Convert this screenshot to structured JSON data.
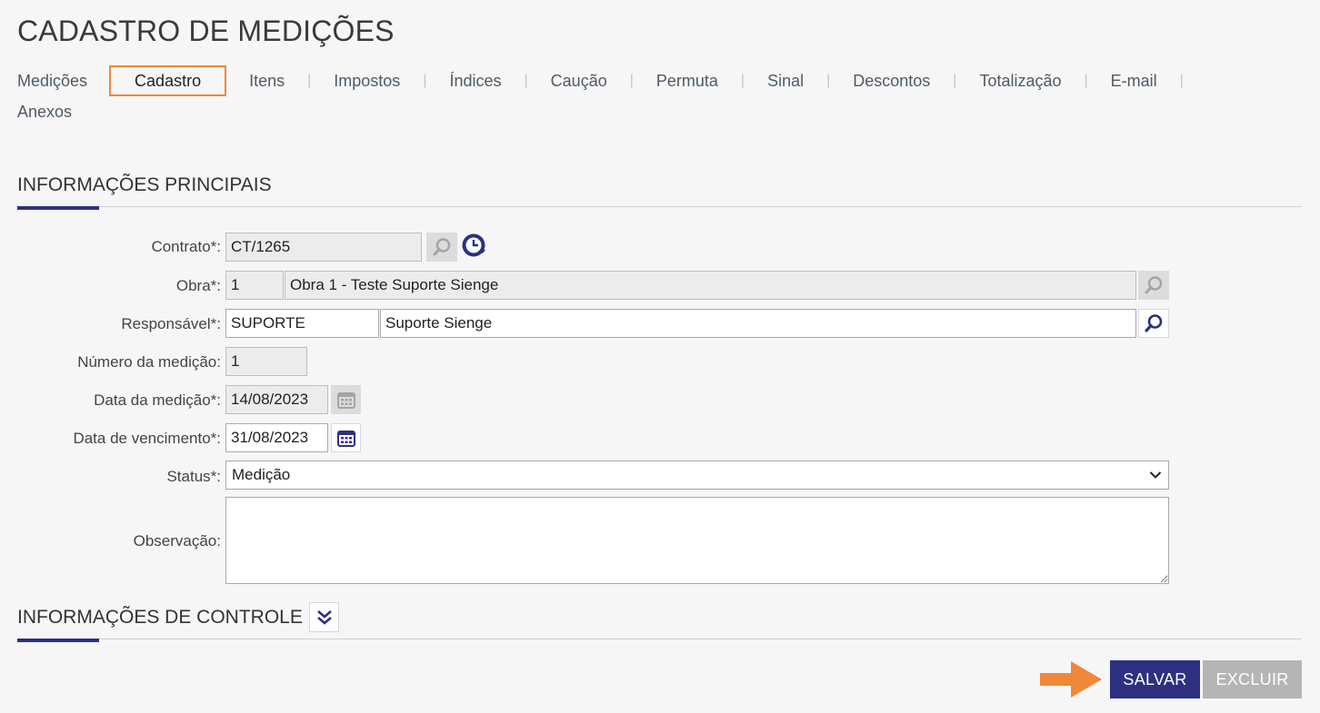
{
  "page": {
    "title": "CADASTRO DE MEDIÇÕES"
  },
  "tabs": {
    "items": [
      {
        "label": "Medições"
      },
      {
        "label": "Cadastro"
      },
      {
        "label": "Itens"
      },
      {
        "label": "Impostos"
      },
      {
        "label": "Índices"
      },
      {
        "label": "Caução"
      },
      {
        "label": "Permuta"
      },
      {
        "label": "Sinal"
      },
      {
        "label": "Descontos"
      },
      {
        "label": "Totalização"
      },
      {
        "label": "E-mail"
      },
      {
        "label": "Anexos"
      }
    ],
    "active": "Cadastro",
    "separator": "|"
  },
  "sections": {
    "main": {
      "title": "INFORMAÇÕES PRINCIPAIS"
    },
    "control": {
      "title": "INFORMAÇÕES DE CONTROLE"
    }
  },
  "form": {
    "contrato": {
      "label": "Contrato*:",
      "value": "CT/1265"
    },
    "obra": {
      "label": "Obra*:",
      "code": "1",
      "name": "Obra 1 - Teste Suporte Sienge"
    },
    "responsavel": {
      "label": "Responsável*:",
      "code": "SUPORTE",
      "name": "Suporte Sienge"
    },
    "numero": {
      "label": "Número da medição:",
      "value": "1"
    },
    "data_medicao": {
      "label": "Data da medição*:",
      "value": "14/08/2023"
    },
    "data_vencimento": {
      "label": "Data de vencimento*:",
      "value": "31/08/2023"
    },
    "status": {
      "label": "Status*:",
      "value": "Medição"
    },
    "observacao": {
      "label": "Observação:",
      "value": ""
    }
  },
  "buttons": {
    "save": "SALVAR",
    "delete": "EXCLUIR"
  },
  "icons": {
    "search": "search-icon",
    "history": "clock-icon",
    "calendar": "calendar-icon",
    "expand": "double-chevron-down-icon",
    "arrow": "arrow-right-icon"
  },
  "colors": {
    "primary": "#2d3081",
    "highlight": "#f0883a",
    "disabled": "#b5b5b5"
  }
}
